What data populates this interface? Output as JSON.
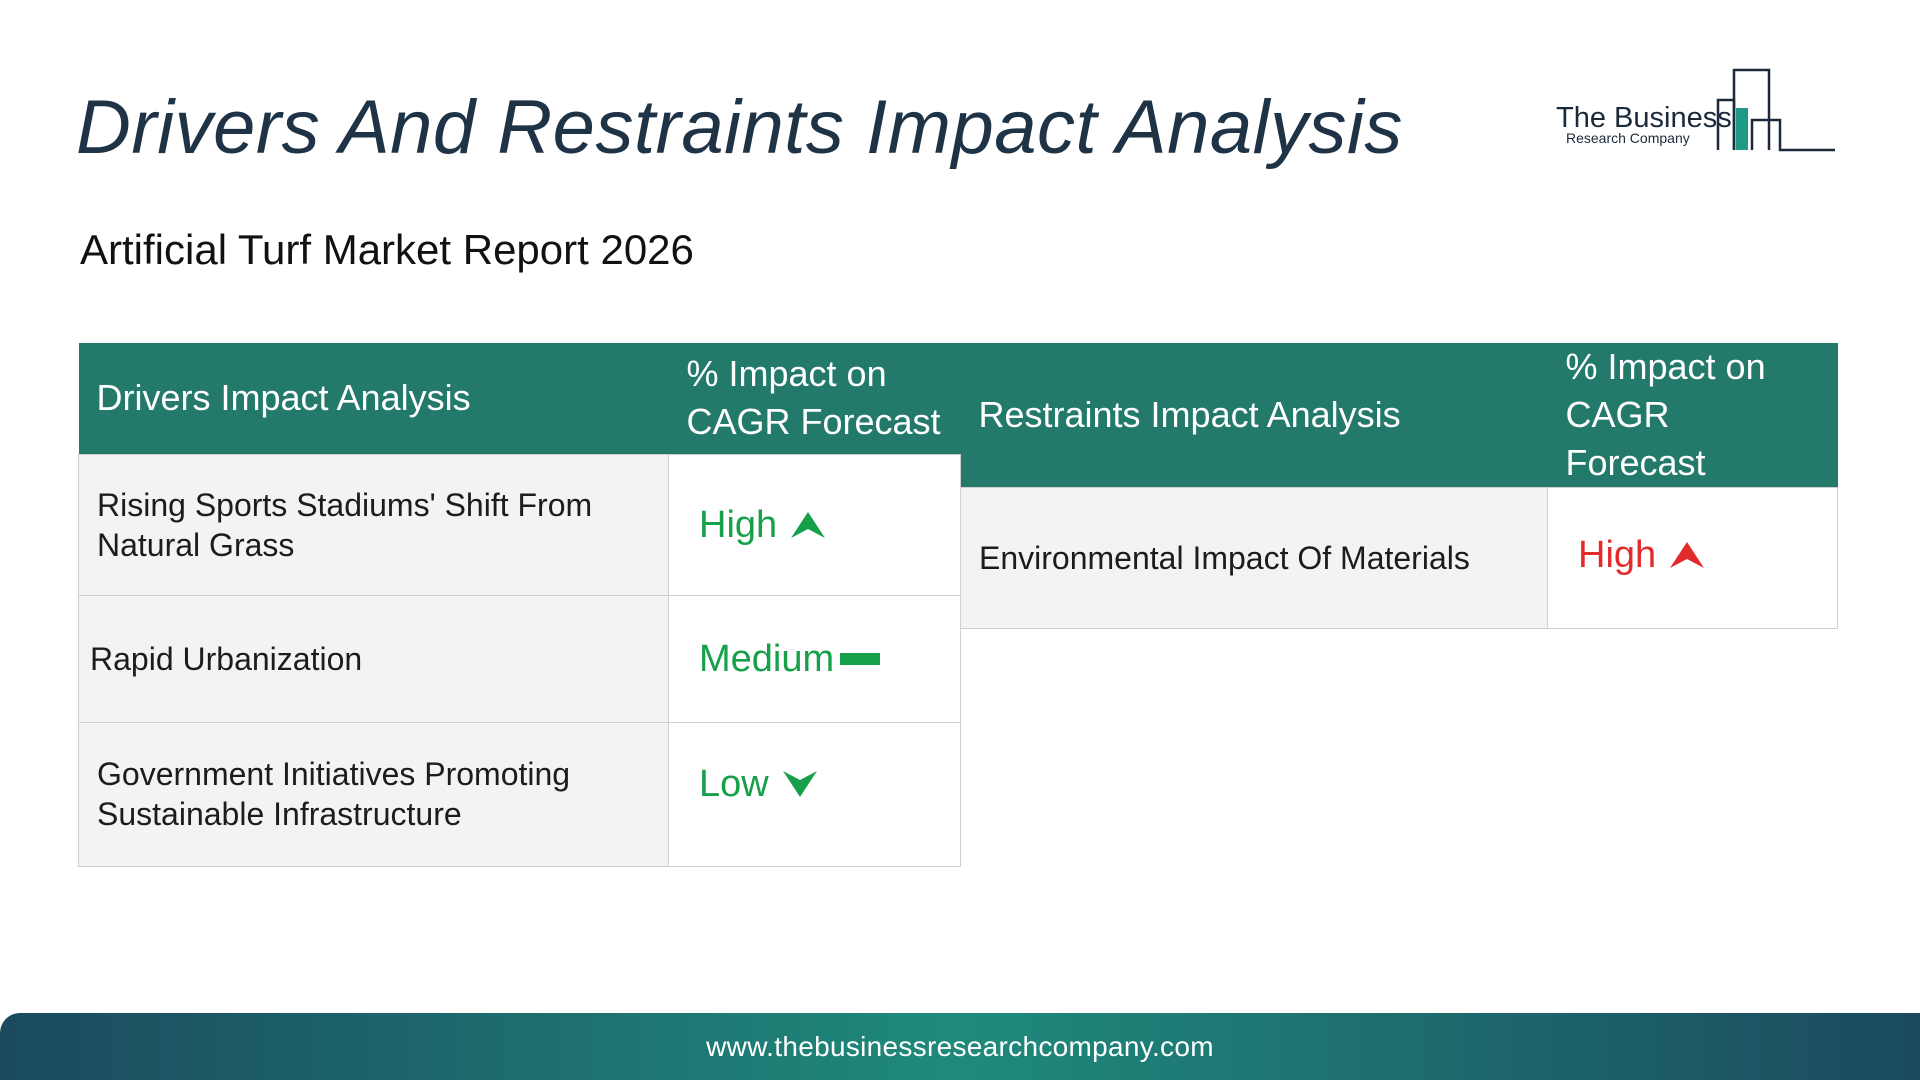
{
  "header": {
    "title": "Drivers And Restraints Impact Analysis",
    "subtitle": "Artificial Turf Market Report 2026"
  },
  "logo": {
    "name": "The Business",
    "tagline": "Research Company",
    "icon": "building-bars-logo-icon",
    "color": "#1f8a7c"
  },
  "drivers_table": {
    "header_factor": "Drivers Impact Analysis",
    "header_impact": "% Impact on CAGR Forecast",
    "header_color": "#247a6a",
    "rows": [
      {
        "factor": "Rising Sports Stadiums' Shift From Natural Grass",
        "impact": "High",
        "trend": "up",
        "icon": "arrow-up-icon",
        "color": "#17a04a"
      },
      {
        "factor": "Rapid Urbanization",
        "impact": "Medium",
        "trend": "flat",
        "icon": "dash-icon",
        "color": "#17a04a"
      },
      {
        "factor": "Government Initiatives Promoting Sustainable Infrastructure",
        "impact": "Low",
        "trend": "down",
        "icon": "arrow-down-icon",
        "color": "#17a04a"
      }
    ]
  },
  "restraints_table": {
    "header_factor": "Restraints Impact Analysis",
    "header_impact": "% Impact on CAGR Forecast",
    "header_color": "#247a6a",
    "rows": [
      {
        "factor": "Environmental Impact Of Materials",
        "impact": "High",
        "trend": "up",
        "icon": "arrow-up-icon",
        "color": "#e32b2b"
      }
    ]
  },
  "footer": {
    "url": "www.thebusinessresearchcompany.com"
  }
}
